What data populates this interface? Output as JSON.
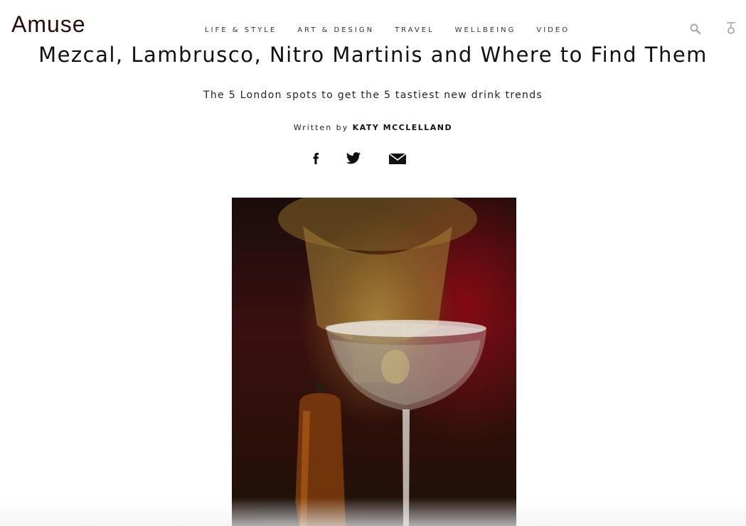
{
  "header": {
    "logo": "Amuse",
    "nav": [
      "LIFE & STYLE",
      "ART & DESIGN",
      "TRAVEL",
      "WELLBEING",
      "VIDEO"
    ],
    "icons": [
      "search-icon",
      "user-icon"
    ]
  },
  "article": {
    "title": "Mezcal, Lambrusco, Nitro Martinis and Where to Find Them",
    "subtitle": "The 5 London spots to get the 5 tastiest new drink trends",
    "byline_prefix": "Written by",
    "author": "KATY MCCLELLAND",
    "share_icons": [
      "facebook-icon",
      "twitter-icon",
      "email-icon"
    ]
  },
  "hero_image": {
    "subject": "martini-coupe-glass",
    "colors": {
      "background": "#3a0f10",
      "accent_gold": "#c9a24a"
    }
  }
}
